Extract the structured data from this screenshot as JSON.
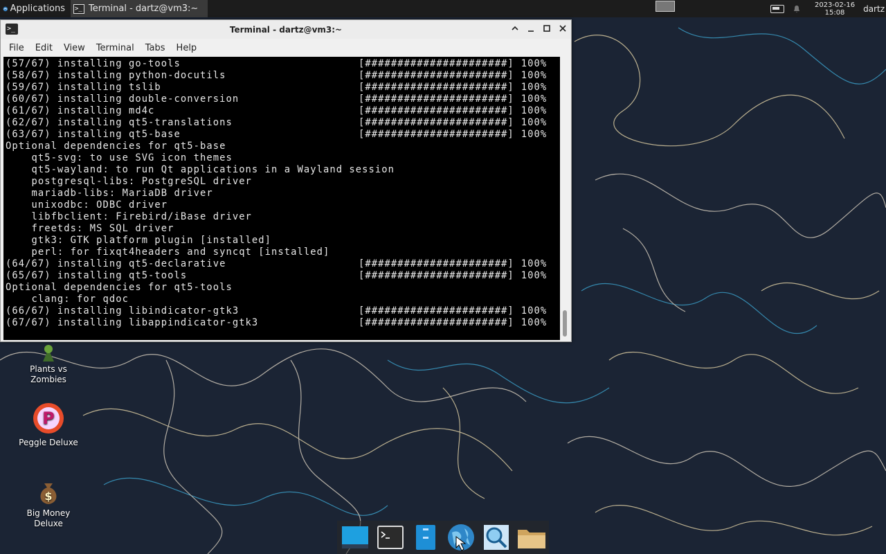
{
  "top_panel": {
    "apps_label": "Applications",
    "task_label": "Terminal - dartz@vm3:~",
    "clock_date": "2023-02-16",
    "clock_time": "15:08",
    "user": "dartz"
  },
  "window": {
    "title": "Terminal - dartz@vm3:~",
    "menu": [
      "File",
      "Edit",
      "View",
      "Terminal",
      "Tabs",
      "Help"
    ]
  },
  "terminal": {
    "progress_bar": "[######################]",
    "lines": [
      {
        "kind": "install",
        "text": "(57/67) installing go-tools",
        "percent": "100%"
      },
      {
        "kind": "install",
        "text": "(58/67) installing python-docutils",
        "percent": "100%"
      },
      {
        "kind": "install",
        "text": "(59/67) installing tslib",
        "percent": "100%"
      },
      {
        "kind": "install",
        "text": "(60/67) installing double-conversion",
        "percent": "100%"
      },
      {
        "kind": "install",
        "text": "(61/67) installing md4c",
        "percent": "100%"
      },
      {
        "kind": "install",
        "text": "(62/67) installing qt5-translations",
        "percent": "100%"
      },
      {
        "kind": "install",
        "text": "(63/67) installing qt5-base",
        "percent": "100%"
      },
      {
        "kind": "text",
        "text": "Optional dependencies for qt5-base"
      },
      {
        "kind": "text",
        "text": "    qt5-svg: to use SVG icon themes"
      },
      {
        "kind": "text",
        "text": "    qt5-wayland: to run Qt applications in a Wayland session"
      },
      {
        "kind": "text",
        "text": "    postgresql-libs: PostgreSQL driver"
      },
      {
        "kind": "text",
        "text": "    mariadb-libs: MariaDB driver"
      },
      {
        "kind": "text",
        "text": "    unixodbc: ODBC driver"
      },
      {
        "kind": "text",
        "text": "    libfbclient: Firebird/iBase driver"
      },
      {
        "kind": "text",
        "text": "    freetds: MS SQL driver"
      },
      {
        "kind": "text",
        "text": "    gtk3: GTK platform plugin [installed]"
      },
      {
        "kind": "text",
        "text": "    perl: for fixqt4headers and syncqt [installed]"
      },
      {
        "kind": "install",
        "text": "(64/67) installing qt5-declarative",
        "percent": "100%"
      },
      {
        "kind": "install",
        "text": "(65/67) installing qt5-tools",
        "percent": "100%"
      },
      {
        "kind": "text",
        "text": "Optional dependencies for qt5-tools"
      },
      {
        "kind": "text",
        "text": "    clang: for qdoc"
      },
      {
        "kind": "install",
        "text": "(66/67) installing libindicator-gtk3",
        "percent": "100%"
      },
      {
        "kind": "install",
        "text": "(67/67) installing libappindicator-gtk3",
        "percent": "100%"
      }
    ]
  },
  "desktop_icons": [
    {
      "label1": "Plants vs",
      "label2": "Zombies"
    },
    {
      "label1": "Peggle Deluxe",
      "label2": ""
    },
    {
      "label1": "Big Money",
      "label2": "Deluxe"
    }
  ],
  "dock": [
    "show-desktop-icon",
    "terminal-icon",
    "file-manager-icon",
    "web-browser-icon",
    "app-finder-icon",
    "folder-icon"
  ]
}
